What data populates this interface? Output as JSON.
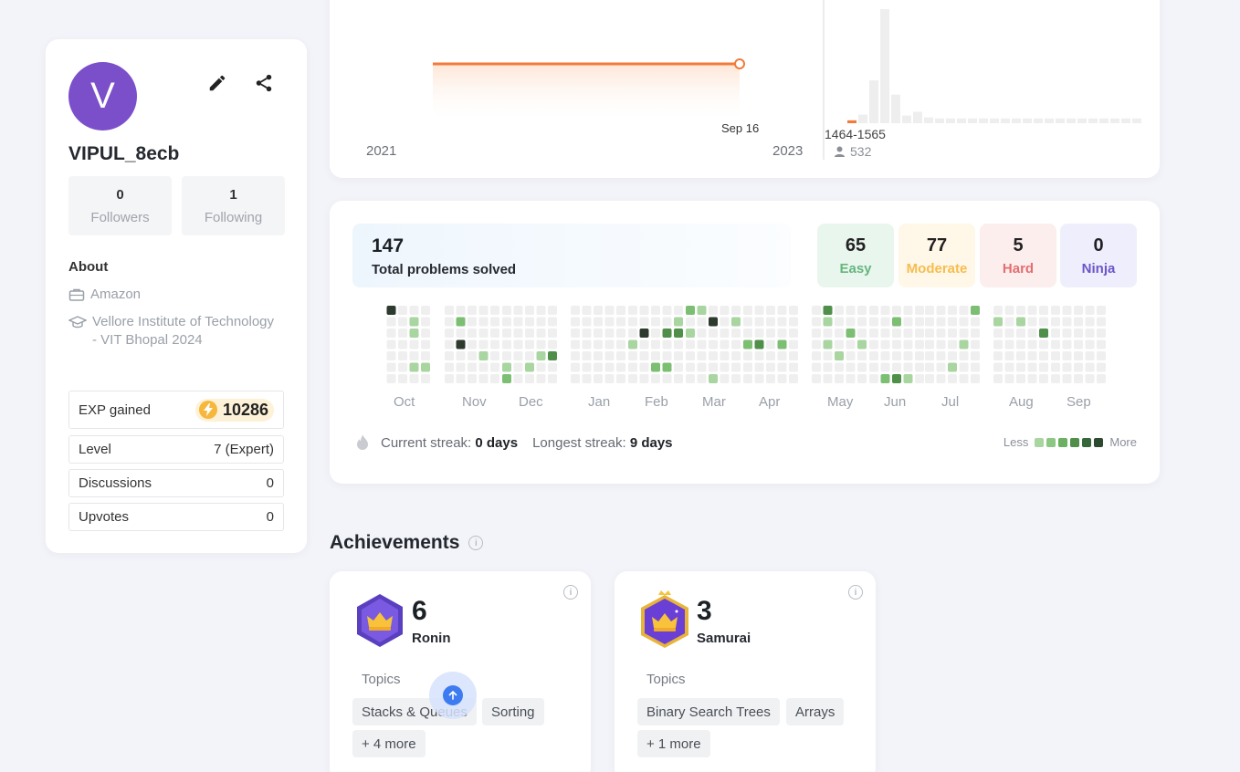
{
  "profile": {
    "avatar_letter": "V",
    "username": "VIPUL_8ecb",
    "followers_count": "0",
    "followers_label": "Followers",
    "following_count": "1",
    "following_label": "Following",
    "about_title": "About",
    "company": "Amazon",
    "education_line1": "Vellore Institute of Technology",
    "education_line2": "- VIT Bhopal 2024",
    "exp_label": "EXP gained",
    "exp_value": "10286",
    "level_label": "Level",
    "level_value": "7 (Expert)",
    "discussions_label": "Discussions",
    "discussions_value": "0",
    "upvotes_label": "Upvotes",
    "upvotes_value": "0"
  },
  "rating": {
    "marker_label": "Sep 16",
    "x_start_label": "2021",
    "x_end_label": "2023",
    "bin_label": "1464-1565",
    "bin_users": "532",
    "accent_color": "#f27a3a"
  },
  "chart_data": {
    "type": "bar",
    "title": "",
    "highlighted_bin": "1464-1565",
    "highlighted_users": 532,
    "values": [
      3,
      9,
      45,
      120,
      30,
      8,
      12,
      6,
      5,
      5,
      5,
      5,
      5,
      5,
      5,
      5,
      5,
      5,
      5,
      5,
      5,
      5,
      5,
      5,
      5,
      5,
      5
    ],
    "highlighted_index": 0
  },
  "solved": {
    "total": "147",
    "total_label": "Total problems solved",
    "easy_count": "65",
    "easy_label": "Easy",
    "moderate_count": "77",
    "moderate_label": "Moderate",
    "hard_count": "5",
    "hard_label": "Hard",
    "ninja_count": "0",
    "ninja_label": "Ninja"
  },
  "heatmap": {
    "months": [
      "Oct",
      "Nov",
      "Dec",
      "Jan",
      "Feb",
      "Mar",
      "Apr",
      "May",
      "Jun",
      "Jul",
      "Aug",
      "Sep"
    ],
    "current_streak_label": "Current streak:",
    "current_streak_value": "0 days",
    "longest_streak_label": "Longest streak:",
    "longest_streak_value": "9 days",
    "legend_less": "Less",
    "legend_more": "More",
    "legend_colors": [
      "#a8d5a0",
      "#8cc884",
      "#6bb063",
      "#4f8f4a",
      "#36673a",
      "#2d4a30"
    ]
  },
  "achievements": {
    "title": "Achievements",
    "cards": [
      {
        "count": "6",
        "name": "Ronin",
        "topics_label": "Topics",
        "chips": [
          "Stacks & Queues",
          "Sorting",
          "+ 4 more"
        ]
      },
      {
        "count": "3",
        "name": "Samurai",
        "topics_label": "Topics",
        "chips": [
          "Binary Search Trees",
          "Arrays",
          "+ 1 more"
        ]
      }
    ]
  }
}
